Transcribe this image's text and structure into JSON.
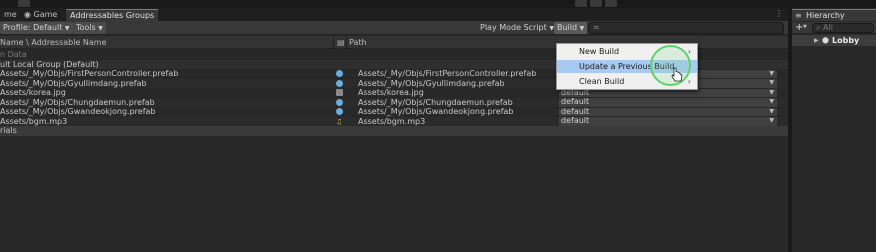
{
  "tabs": [
    {
      "label": "me"
    },
    {
      "label": "Game"
    },
    {
      "label": "Addressables Groups"
    }
  ],
  "toolbar": {
    "profile": "Profile: Default",
    "tools": "Tools",
    "play_mode_script": "Play Mode Script",
    "build": "Build",
    "search_prefix": "≈"
  },
  "columns": {
    "name": "Name \\ Addressable Name",
    "path": "Path"
  },
  "rows": [
    {
      "name": "n Data",
      "path": "",
      "icon": "none",
      "type": "faded"
    },
    {
      "name": "ult Local Group (Default)",
      "path": "",
      "icon": "none",
      "type": "group"
    },
    {
      "name": "Assets/_My/Objs/FirstPersonController.prefab",
      "path": "Assets/_My/Objs/FirstPersonController.prefab",
      "icon": "prefab-icon",
      "label": "default"
    },
    {
      "name": "Assets/_My/Objs/Gyullimdang.prefab",
      "path": "Assets/_My/Objs/Gyullimdang.prefab",
      "icon": "prefab-icon",
      "label": "default"
    },
    {
      "name": "Assets/korea.jpg",
      "path": "Assets/korea.jpg",
      "icon": "image-icon",
      "label": "default"
    },
    {
      "name": "Assets/_My/Objs/Chungdaemun.prefab",
      "path": "Assets/_My/Objs/Chungdaemun.prefab",
      "icon": "prefab-icon",
      "label": "default"
    },
    {
      "name": "Assets/_My/Objs/Gwandeokjong.prefab",
      "path": "Assets/_My/Objs/Gwandeokjong.prefab",
      "icon": "prefab-icon",
      "label": "default"
    },
    {
      "name": "Assets/bgm.mp3",
      "path": "Assets/bgm.mp3",
      "icon": "audio-icon",
      "label": "default"
    },
    {
      "name": "rials",
      "path": "",
      "icon": "none",
      "type": "section"
    }
  ],
  "build_menu": {
    "items": [
      {
        "label": "New Build",
        "submenu": true
      },
      {
        "label": "Update a Previous Build",
        "highlighted": true
      },
      {
        "label": "Clean Build",
        "submenu": true
      }
    ]
  },
  "hierarchy": {
    "title": "Hierarchy",
    "search_placeholder": "All",
    "scene": "Lobby"
  },
  "colors": {
    "accent": "#4a7fcf",
    "highlight": "#a8c9f2",
    "cursor_ring": "#5fd36a"
  }
}
